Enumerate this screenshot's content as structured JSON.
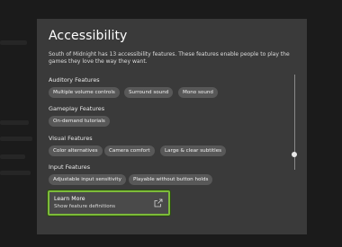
{
  "dialog": {
    "title": "Accessibility",
    "description": "South of Midnight has 13 accessibility features. These features enable people to play the games they love the way they want."
  },
  "sections": [
    {
      "label": "Auditory Features",
      "chips": [
        "Multiple volume controls",
        "Surround sound",
        "Mono sound"
      ]
    },
    {
      "label": "Gameplay Features",
      "chips": [
        "On-demand tutorials"
      ]
    },
    {
      "label": "Visual Features",
      "chips": [
        "Color alternatives",
        "Camera comfort",
        "Large & clear subtitles"
      ]
    },
    {
      "label": "Input Features",
      "chips": [
        "Adjustable input sensitivity",
        "Playable without button holds"
      ]
    }
  ],
  "learn_more": {
    "title": "Learn More",
    "subtitle": "Show feature definitions",
    "icon": "external-link-icon"
  },
  "scroll": {
    "position_fraction": 0.8
  },
  "colors": {
    "focus": "#7dbb3a",
    "panel": "#3a3a3a",
    "chip": "#585858"
  }
}
